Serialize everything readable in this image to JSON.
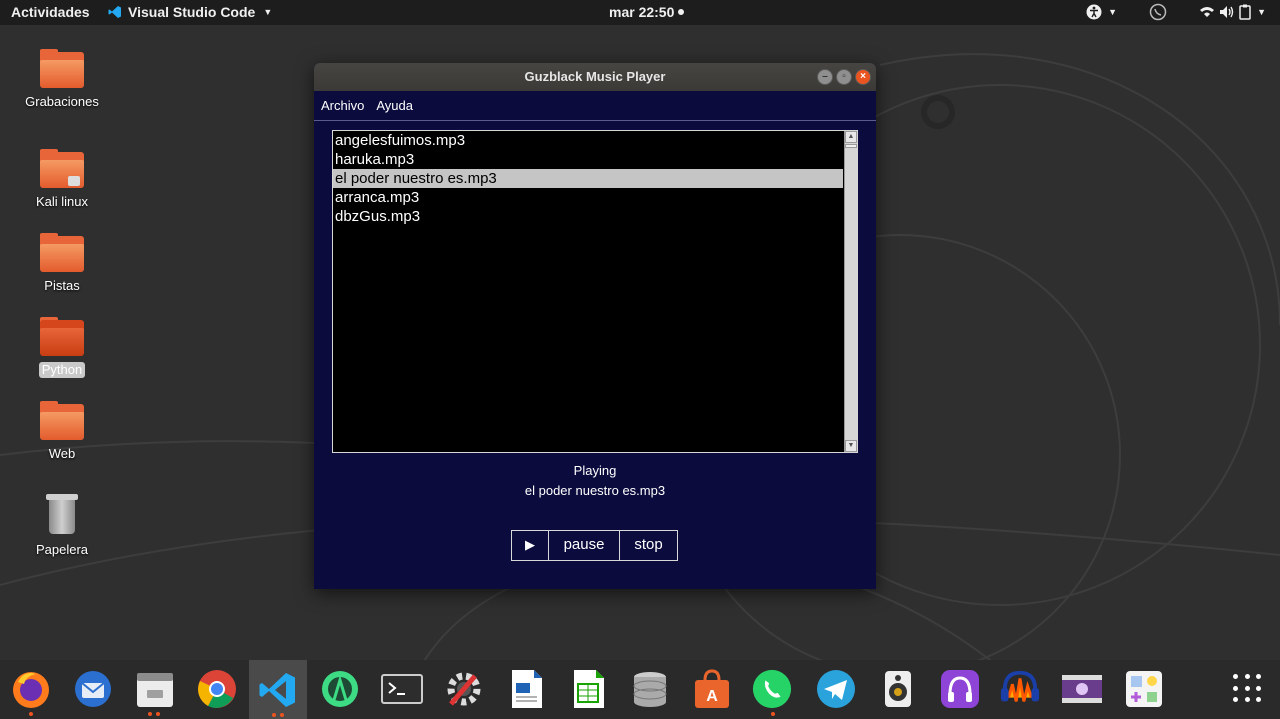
{
  "topbar": {
    "activities": "Actividades",
    "app_name": "Visual Studio Code",
    "clock": "mar 22:50"
  },
  "desktop": {
    "items": [
      {
        "label": "Grabaciones",
        "icon": "folder-icon"
      },
      {
        "label": "Kali linux",
        "icon": "locked-folder-icon"
      },
      {
        "label": "Pistas",
        "icon": "folder-icon"
      },
      {
        "label": "Python",
        "icon": "folder-icon"
      },
      {
        "label": "Web",
        "icon": "folder-icon"
      },
      {
        "label": "Papelera",
        "icon": "trash-icon"
      }
    ]
  },
  "window": {
    "title": "Guzblack Music Player",
    "menu": [
      "Archivo",
      "Ayuda"
    ],
    "playlist": [
      "angelesfuimos.mp3",
      "haruka.mp3",
      "el poder nuestro es.mp3",
      "arranca.mp3",
      "dbzGus.mp3"
    ],
    "selected_index": 2,
    "status_label": "Playing",
    "status_track": "el poder nuestro es.mp3",
    "buttons": {
      "play": "▶",
      "pause": "pause",
      "stop": "stop"
    }
  },
  "dock": {
    "apps": [
      "firefox-icon",
      "thunderbird-icon",
      "files-icon",
      "chrome-icon",
      "vscode-icon",
      "android-studio-icon",
      "terminal-icon",
      "settings-tool-icon",
      "writer-icon",
      "calc-icon",
      "database-icon",
      "software-center-icon",
      "whatsapp-icon",
      "telegram-icon",
      "speaker-icon",
      "podcast-icon",
      "audacity-icon",
      "video-editor-icon",
      "games-icon"
    ]
  },
  "colors": {
    "window_bg": "#0b0b3d",
    "accent": "#e95420"
  }
}
